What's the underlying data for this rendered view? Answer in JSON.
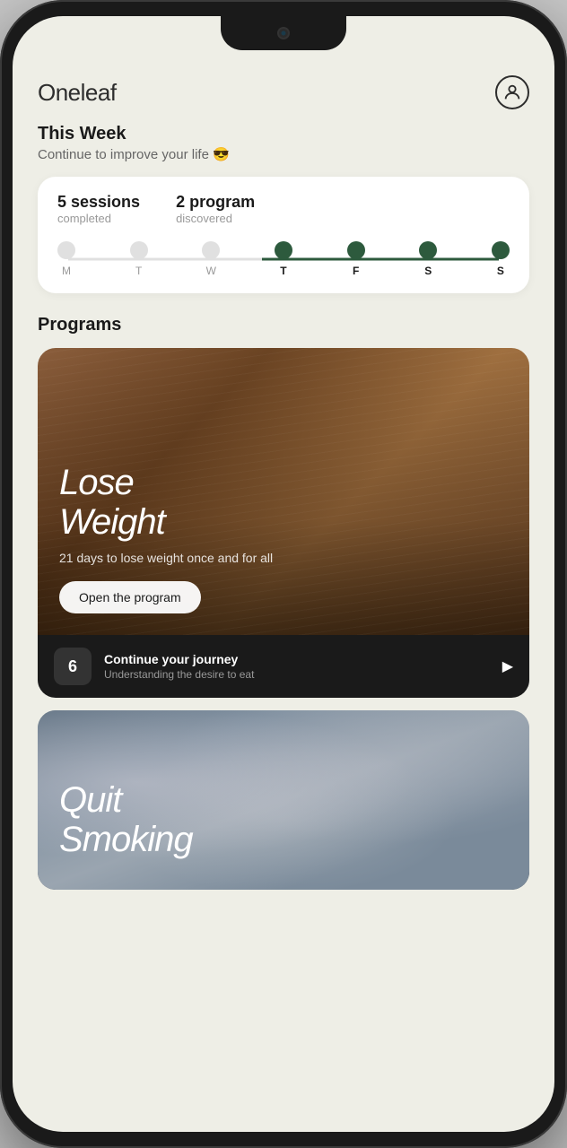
{
  "app": {
    "logo": "Oneleaf"
  },
  "header": {
    "avatar_label": "user profile"
  },
  "week": {
    "title": "This Week",
    "subtitle": "Continue to improve your life 😎",
    "stats": {
      "sessions_value": "5 sessions",
      "sessions_label": "completed",
      "programs_value": "2 program",
      "programs_label": "discovered"
    },
    "days": [
      {
        "label": "M",
        "active": false
      },
      {
        "label": "T",
        "active": false
      },
      {
        "label": "W",
        "active": false
      },
      {
        "label": "T",
        "active": true
      },
      {
        "label": "F",
        "active": true
      },
      {
        "label": "S",
        "active": true
      },
      {
        "label": "S",
        "active": true
      }
    ]
  },
  "programs": {
    "section_title": "Programs",
    "items": [
      {
        "name": "Lose\nWeight",
        "description": "21 days to lose weight once and for all",
        "open_label": "Open the program",
        "session_number": "6",
        "session_title": "Continue your journey",
        "session_subtitle": "Understanding the desire to eat"
      },
      {
        "name": "Quit\nSmoking",
        "description": "",
        "open_label": ""
      }
    ]
  }
}
